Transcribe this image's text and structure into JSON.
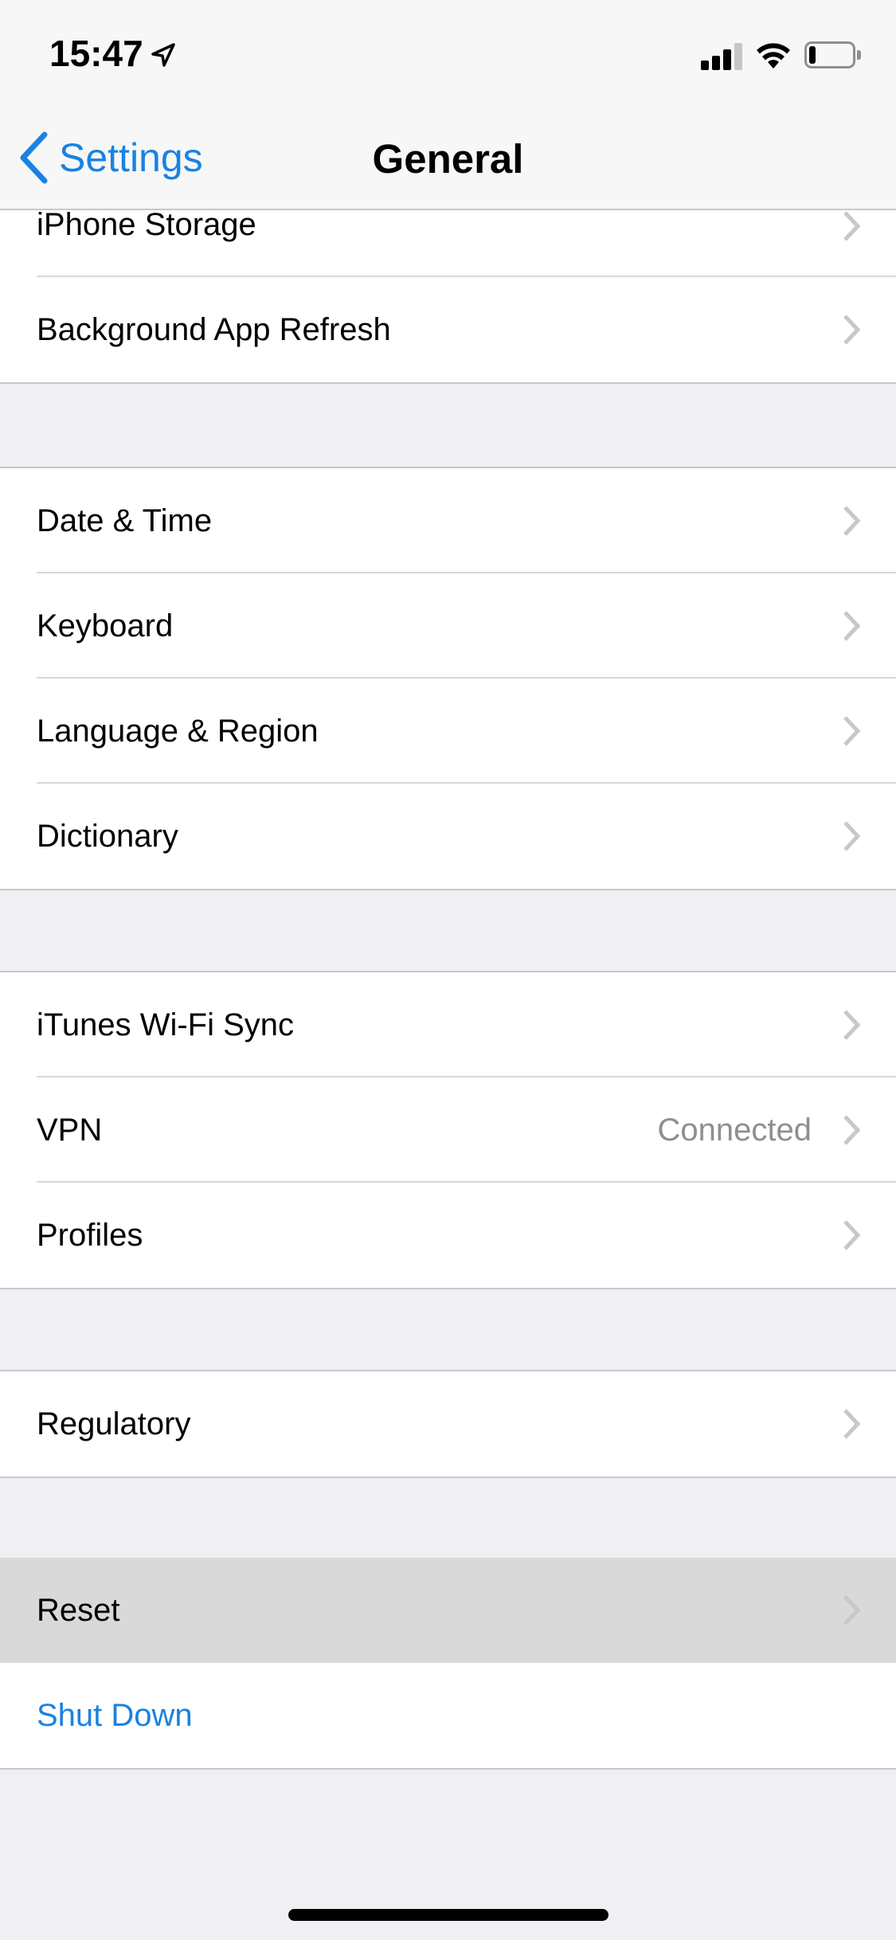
{
  "status_bar": {
    "time": "15:47",
    "location_icon": "location-arrow-icon",
    "signal_bars_active": 3,
    "signal_bars_total": 4,
    "wifi_icon": "wifi-icon",
    "battery_level_percent": 15
  },
  "nav": {
    "back_label": "Settings",
    "back_icon": "chevron-left-icon",
    "title": "General"
  },
  "colors": {
    "accent": "#1a82e2",
    "background": "#efeff4",
    "detail_text": "#8e8e93",
    "pressed_row": "#d9d9d9"
  },
  "groups": [
    {
      "rows": [
        {
          "label": "iPhone Storage",
          "chevron": true
        },
        {
          "label": "Background App Refresh",
          "chevron": true
        }
      ]
    },
    {
      "rows": [
        {
          "label": "Date & Time",
          "chevron": true
        },
        {
          "label": "Keyboard",
          "chevron": true
        },
        {
          "label": "Language & Region",
          "chevron": true
        },
        {
          "label": "Dictionary",
          "chevron": true
        }
      ]
    },
    {
      "rows": [
        {
          "label": "iTunes Wi-Fi Sync",
          "chevron": true
        },
        {
          "label": "VPN",
          "detail": "Connected",
          "chevron": true
        },
        {
          "label": "Profiles",
          "chevron": true
        }
      ]
    },
    {
      "rows": [
        {
          "label": "Regulatory",
          "chevron": true
        }
      ]
    },
    {
      "rows": [
        {
          "label": "Reset",
          "chevron": true,
          "pressed": true
        },
        {
          "label": "Shut Down",
          "chevron": false,
          "action": true
        }
      ]
    }
  ]
}
